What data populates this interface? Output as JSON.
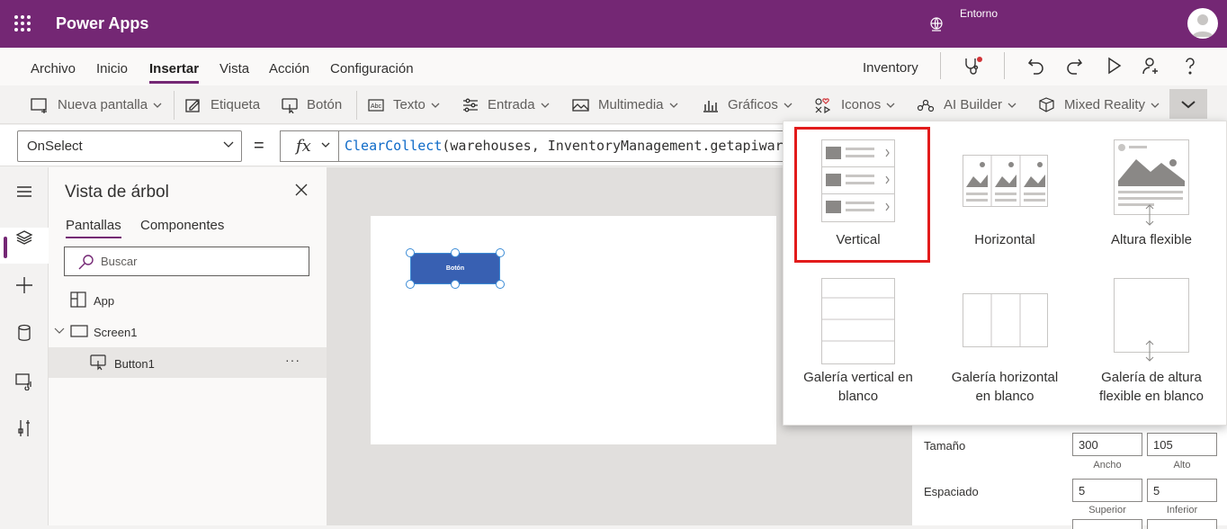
{
  "header": {
    "app_title": "Power Apps",
    "env_label": "Entorno"
  },
  "menu": {
    "items": [
      "Archivo",
      "Inicio",
      "Insertar",
      "Vista",
      "Acción",
      "Configuración"
    ],
    "active": "Insertar",
    "app_name": "Inventory"
  },
  "ribbon": {
    "items": [
      {
        "label": "Nueva pantalla",
        "icon": "new-screen-icon"
      },
      {
        "label": "Etiqueta",
        "icon": "label-icon"
      },
      {
        "label": "Botón",
        "icon": "button-icon"
      },
      {
        "label": "Texto",
        "icon": "text-icon"
      },
      {
        "label": "Entrada",
        "icon": "input-icon"
      },
      {
        "label": "Multimedia",
        "icon": "media-icon"
      },
      {
        "label": "Gráficos",
        "icon": "chart-icon"
      },
      {
        "label": "Iconos",
        "icon": "icons-icon"
      },
      {
        "label": "AI Builder",
        "icon": "ai-builder-icon"
      },
      {
        "label": "Mixed Reality",
        "icon": "mixed-reality-icon"
      }
    ]
  },
  "formula_bar": {
    "property": "OnSelect",
    "fx_label": "fx",
    "fn_name": "ClearCollect",
    "formula_rest": "(warehouses, InventoryManagement.getapiwarehouses())"
  },
  "tree": {
    "title": "Vista de árbol",
    "tabs": [
      "Pantallas",
      "Componentes"
    ],
    "search_placeholder": "Buscar",
    "nodes": [
      "App",
      "Screen1",
      "Button1"
    ],
    "more": "···"
  },
  "canvas": {
    "button_text": "Botón"
  },
  "flyout": {
    "galleries": [
      [
        "Vertical",
        ""
      ],
      [
        "Horizontal",
        ""
      ],
      [
        "Altura flexible",
        ""
      ],
      [
        "Galería vertical en",
        "blanco"
      ],
      [
        "Galería horizontal",
        "en blanco"
      ],
      [
        "Galería de altura",
        "flexible en blanco"
      ]
    ]
  },
  "properties": {
    "size_label": "Tamaño",
    "width": "300",
    "height": "105",
    "width_label": "Ancho",
    "height_label": "Alto",
    "spacing_label": "Espaciado",
    "top": "5",
    "bottom": "5",
    "top_label": "Superior",
    "bottom_label": "Inferior"
  },
  "colors": {
    "brand": "#742774",
    "highlight": "#e21b1b",
    "app_button": "#3860b2"
  }
}
